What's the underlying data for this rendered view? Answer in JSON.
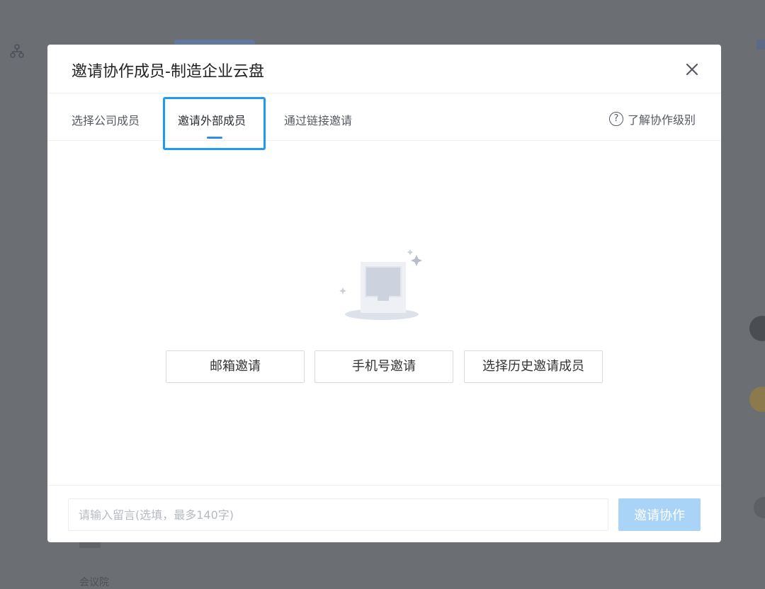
{
  "modal": {
    "title": "邀请协作成员-制造企业云盘"
  },
  "tabs": [
    {
      "label": "选择公司成员"
    },
    {
      "label": "邀请外部成员",
      "active": true
    },
    {
      "label": "通过链接邀请"
    }
  ],
  "help": {
    "label": "了解协作级别",
    "icon_char": "?"
  },
  "actions": {
    "email": "邮箱邀请",
    "phone": "手机号邀请",
    "history": "选择历史邀请成员"
  },
  "footer": {
    "message_placeholder": "请输入留言(选填，最多140字)",
    "invite_label": "邀请协作"
  },
  "background": {
    "bottom_text": "会议院"
  },
  "colors": {
    "accent": "#2f8ee5",
    "highlight_border": "#1e9bf0",
    "invite_button_disabled": "#a9d3f7",
    "overlay": "#6b6e73"
  }
}
